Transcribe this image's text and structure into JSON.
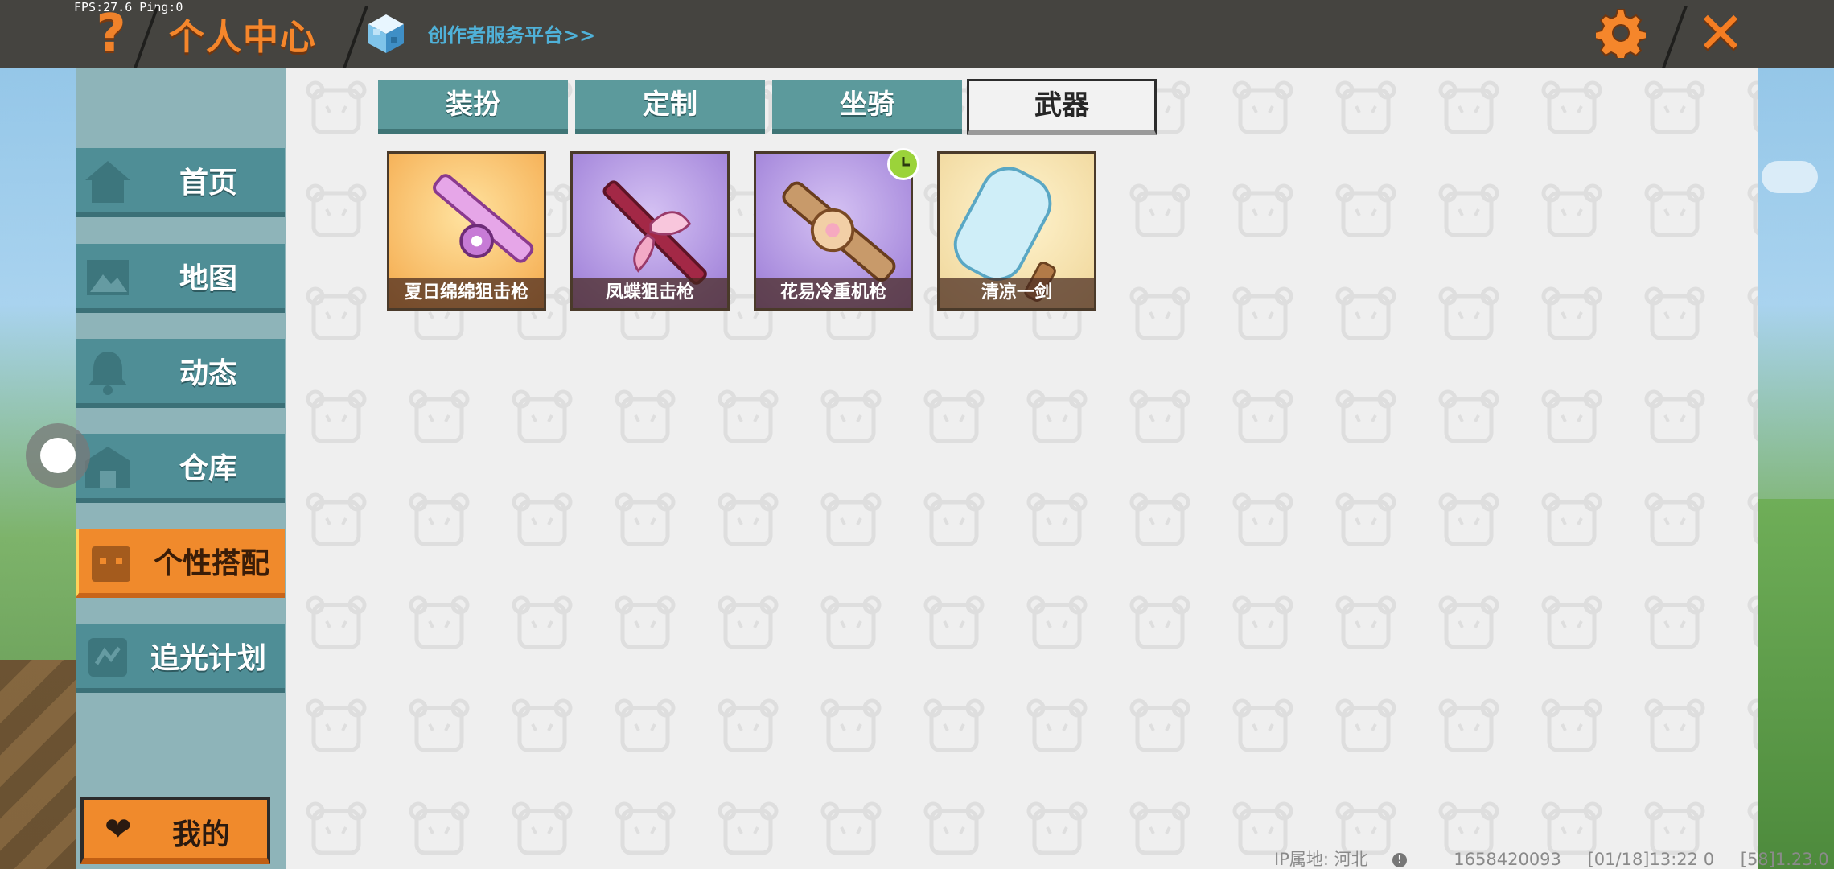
{
  "status": {
    "fps_text": "FPS:27.6  Ping:0"
  },
  "header": {
    "help_glyph": "?",
    "title": "个人中心",
    "creator_link": "创作者服务平台>>",
    "close_glyph": "✕",
    "icons": {
      "help": "question-icon",
      "creator": "cube-icon",
      "settings": "gear-icon",
      "close": "close-icon"
    },
    "accent_color": "#f5862b"
  },
  "sidebar": {
    "items": [
      {
        "label": "首页",
        "icon": "home-icon"
      },
      {
        "label": "地图",
        "icon": "map-icon"
      },
      {
        "label": "动态",
        "icon": "bell-icon"
      },
      {
        "label": "仓库",
        "icon": "warehouse-icon"
      },
      {
        "label": "个性搭配",
        "icon": "outfit-icon",
        "active": true
      },
      {
        "label": "追光计划",
        "icon": "plan-icon"
      }
    ],
    "mine_label": "我的",
    "mine_icon": "heart-icon"
  },
  "tabs": [
    {
      "label": "装扮"
    },
    {
      "label": "定制"
    },
    {
      "label": "坐骑"
    },
    {
      "label": "武器",
      "active": true
    }
  ],
  "items": [
    {
      "name": "夏日绵绵狙击枪",
      "bg": "orange",
      "limited": false
    },
    {
      "name": "凤蝶狙击枪",
      "bg": "purple",
      "limited": false
    },
    {
      "name": "花易冷重机枪",
      "bg": "purple",
      "limited": true
    },
    {
      "name": "清凉一剑",
      "bg": "yellow",
      "limited": false
    }
  ],
  "footer": {
    "ip_location": "IP属地: 河北",
    "info_glyph": "!",
    "user_id": "1658420093",
    "date_time": "[01/18]13:22 0",
    "version": "[58]1.23.0"
  },
  "colors": {
    "topbar": "#454440",
    "nav": "#4f8e96",
    "nav_active": "#f08a2c",
    "tab": "#5c9a9c",
    "limited_badge": "#9bd33a"
  }
}
